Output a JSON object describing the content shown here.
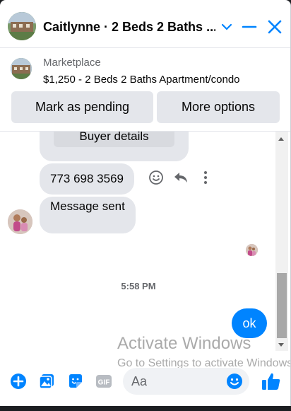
{
  "header": {
    "title": "Caitlynne · 2 Beds 2 Baths ...",
    "accent": "#0084ff"
  },
  "marketplace": {
    "label": "Marketplace",
    "item": "$1,250 - 2 Beds 2 Baths Apartment/condo",
    "mark_pending_label": "Mark as pending",
    "more_options_label": "More options"
  },
  "thread": {
    "card_button_label": "Buyer details",
    "phone_message": "773 698 3569",
    "sent_message": "Message sent",
    "timestamp": "5:58 PM",
    "my_message": "ok"
  },
  "overlay": {
    "activate_title": "Activate Windows",
    "activate_sub": "Go to Settings to activate Windows."
  },
  "composer": {
    "placeholder": "Aa",
    "icons": [
      "plus-icon",
      "photo-icon",
      "sticker-icon",
      "gif-icon",
      "emoji-icon",
      "like-icon"
    ]
  }
}
